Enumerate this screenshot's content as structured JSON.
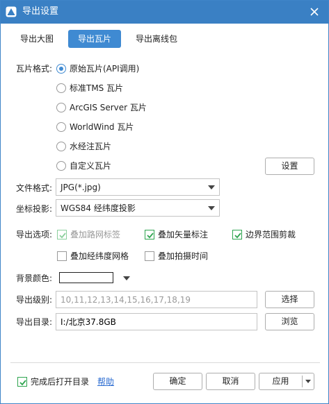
{
  "window": {
    "title": "导出设置"
  },
  "tabs": [
    {
      "label": "导出大图",
      "active": false
    },
    {
      "label": "导出瓦片",
      "active": true
    },
    {
      "label": "导出离线包",
      "active": false
    }
  ],
  "tile_format": {
    "label": "瓦片格式:",
    "options": [
      {
        "label": "原始瓦片(API调用)",
        "selected": true
      },
      {
        "label": "标准TMS 瓦片",
        "selected": false
      },
      {
        "label": "ArcGIS Server 瓦片",
        "selected": false
      },
      {
        "label": "WorldWind 瓦片",
        "selected": false
      },
      {
        "label": "水经注瓦片",
        "selected": false
      },
      {
        "label": "自定义瓦片",
        "selected": false
      }
    ],
    "settings_button": "设置"
  },
  "file_format": {
    "label": "文件格式:",
    "value": "JPG(*.jpg)"
  },
  "projection": {
    "label": "坐标投影:",
    "value": "WGS84 经纬度投影"
  },
  "export_options": {
    "label": "导出选项:",
    "items": [
      {
        "label": "叠加路网标签",
        "checked": true,
        "disabled": true
      },
      {
        "label": "叠加矢量标注",
        "checked": true,
        "disabled": false
      },
      {
        "label": "边界范围剪裁",
        "checked": true,
        "disabled": false
      },
      {
        "label": "叠加经纬度网格",
        "checked": false,
        "disabled": false
      },
      {
        "label": "叠加拍摄时间",
        "checked": false,
        "disabled": false
      }
    ]
  },
  "background_color": {
    "label": "背景颜色:",
    "value": "#ffffff"
  },
  "export_level": {
    "label": "导出级别:",
    "value": "10,11,12,13,14,15,16,17,18,19",
    "button": "选择"
  },
  "export_dir": {
    "label": "导出目录:",
    "value": "I:/北京37.8GB",
    "button": "浏览"
  },
  "footer": {
    "open_dir_label": "完成后打开目录",
    "open_dir_checked": true,
    "help_link": "帮助",
    "ok_button": "确定",
    "cancel_button": "取消",
    "apply_button": "应用"
  },
  "colors": {
    "titlebar": "#3a80c4",
    "accent": "#3f8ad2",
    "check_green": "#2ea44f",
    "link": "#2a6bd1"
  }
}
